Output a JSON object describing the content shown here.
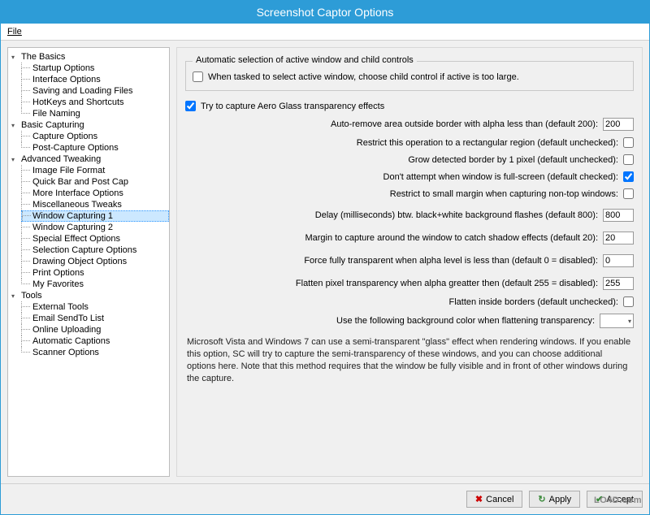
{
  "window": {
    "title": "Screenshot Captor Options"
  },
  "menubar": {
    "file": "File"
  },
  "tree": [
    {
      "label": "The Basics",
      "items": [
        "Startup Options",
        "Interface Options",
        "Saving and Loading Files",
        "HotKeys and Shortcuts",
        "File Naming"
      ]
    },
    {
      "label": "Basic Capturing",
      "items": [
        "Capture Options",
        "Post-Capture Options"
      ]
    },
    {
      "label": "Advanced Tweaking",
      "items": [
        "Image File Format",
        "Quick Bar and Post Cap",
        "More Interface Options",
        "Miscellaneous Tweaks",
        "Window Capturing 1",
        "Window Capturing 2",
        "Special Effect Options",
        "Selection Capture Options",
        "Drawing Object Options",
        "Print Options",
        "My Favorites"
      ],
      "selected": 4
    },
    {
      "label": "Tools",
      "items": [
        "External Tools",
        "Email SendTo List",
        "Online Uploading",
        "Automatic Captions",
        "Scanner Options"
      ]
    }
  ],
  "panel": {
    "group1": {
      "title": "Automatic selection of active window and child controls",
      "opt1": "When tasked to select active window, choose child control if active is too large."
    },
    "aero_check": "Try to capture Aero Glass transparency effects",
    "aero_checked": true,
    "auto_remove_label": "Auto-remove area outside border with alpha less than (default 200):",
    "auto_remove_value": "200",
    "restrict_rect": "Restrict this operation to a rectangular region (default unchecked):",
    "grow_border": "Grow detected border by 1 pixel (default unchecked):",
    "no_fullscreen": "Don't attempt when window is full-screen (default checked):",
    "no_fullscreen_checked": true,
    "restrict_margin": "Restrict to small margin when capturing non-top windows:",
    "delay_label": "Delay (milliseconds) btw. black+white background flashes (default 800):",
    "delay_value": "800",
    "margin_label": "Margin to capture around the window to catch shadow effects (default 20):",
    "margin_value": "20",
    "force_trans_label": "Force fully transparent when alpha level is less than (default 0 = disabled):",
    "force_trans_value": "0",
    "flatten_label": "Flatten pixel transparency when alpha greatter then (default 255 = disabled):",
    "flatten_value": "255",
    "flatten_inside": "Flatten inside borders (default unchecked):",
    "bgcolor_label": "Use the following background color when flattening transparency:",
    "description": "Microsoft Vista and Windows 7 can use a semi-transparent \"glass\" effect when rendering windows.  If you enable this option, SC will try to capture the semi-transparency of these windows, and you can choose additional options here.  Note that this method requires that the window be fully visible and in front of other windows during the capture."
  },
  "buttons": {
    "cancel": "Cancel",
    "apply": "Apply",
    "accept": "Accept"
  },
  "watermark": "LO4D.com"
}
